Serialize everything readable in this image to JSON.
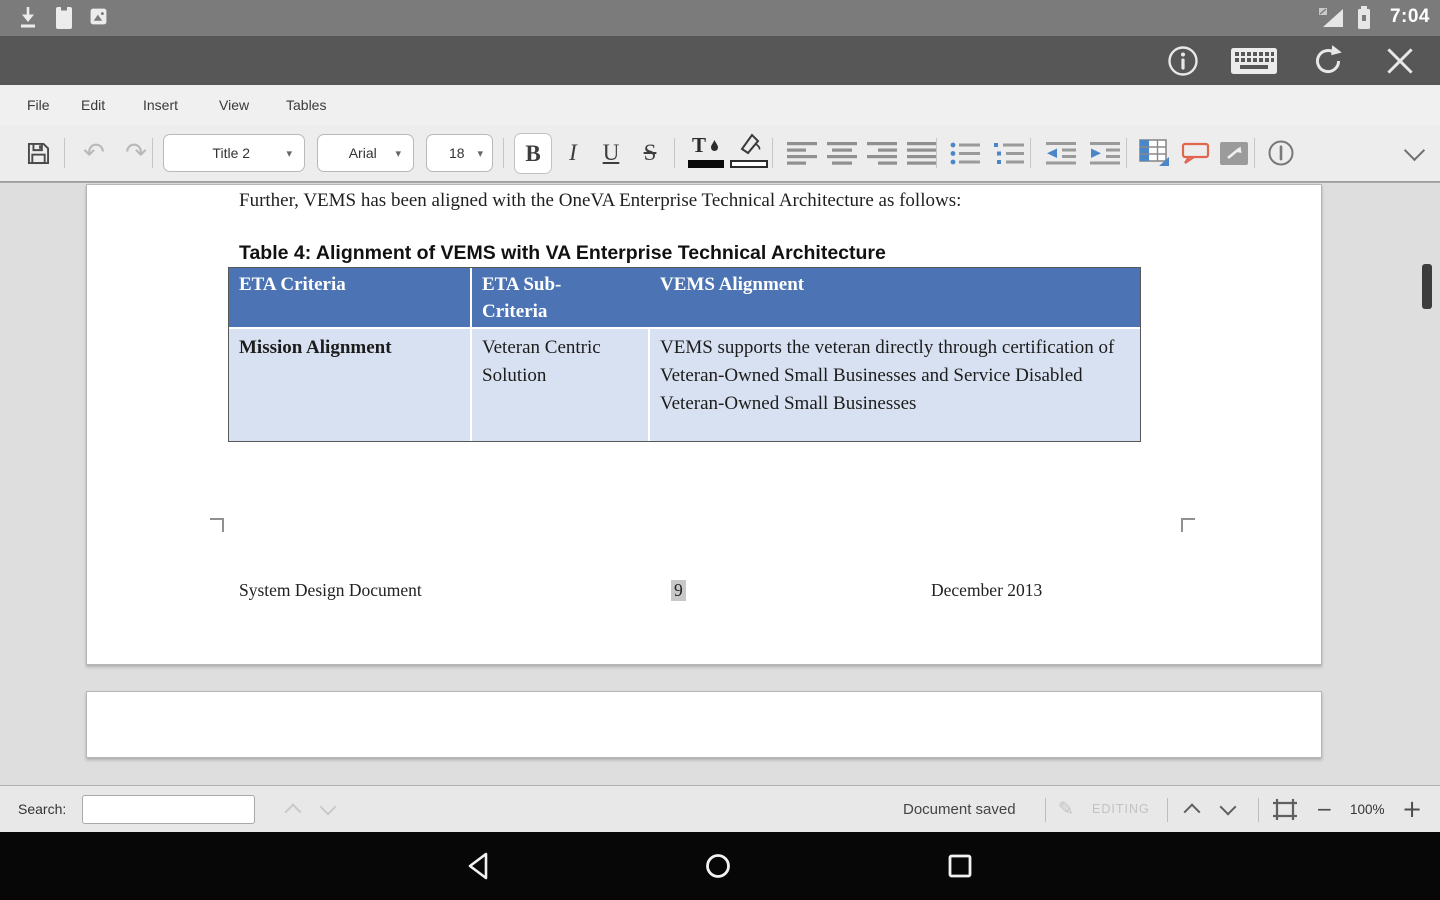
{
  "status_bar": {
    "time": "7:04"
  },
  "menu_bar": {
    "items": [
      "File",
      "Edit",
      "Insert",
      "View",
      "Tables"
    ]
  },
  "toolbar": {
    "style_label": "Title 2",
    "font_label": "Arial",
    "size_label": "18",
    "bold": "B",
    "italic": "I",
    "underline": "U",
    "strike": "S"
  },
  "icons": {
    "undo": "↶",
    "redo": "↷",
    "caret": "▾",
    "pencil": "✎",
    "minus": "−",
    "plus": "+"
  },
  "document": {
    "paragraph": "Further, VEMS has been aligned with the OneVA Enterprise Technical Architecture as follows:",
    "table_caption": "Table 4: Alignment of VEMS with VA Enterprise Technical Architecture",
    "table": {
      "headers": [
        "ETA Criteria",
        "ETA Sub-Criteria",
        "VEMS Alignment"
      ],
      "rows": [
        {
          "criteria": "Mission Alignment",
          "sub_criteria": "Veteran Centric Solution",
          "alignment": "VEMS supports the veteran directly through certification of Veteran-Owned Small Businesses and Service Disabled Veteran-Owned Small Businesses"
        }
      ]
    },
    "footer": {
      "left": "System Design Document",
      "page_number": "9",
      "right": "December 2013"
    }
  },
  "search_bar": {
    "label": "Search:",
    "input_value": ""
  },
  "status_strip": {
    "saved": "Document saved",
    "mode": "EDITING",
    "zoom_value": "100%"
  },
  "colors": {
    "table_header_bg": "#4C74B4",
    "table_row_bg": "#D8E1F1",
    "comment_accent": "#E0664F",
    "icon_accent_blue": "#4A86C8"
  }
}
